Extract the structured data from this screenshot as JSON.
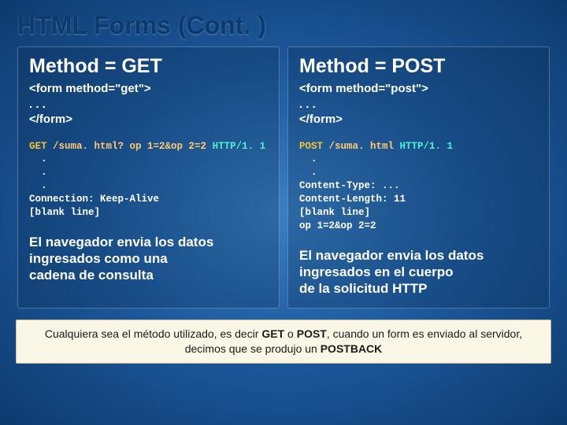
{
  "title": "HTML Forms (Cont. )",
  "left": {
    "heading": "Method = GET",
    "form_line1": "<form method=\"get\">",
    "form_line2": ". . .",
    "form_line3": "</form>",
    "http": {
      "method": "GET",
      "url": " /suma. html? op 1=2&op 2=2 ",
      "proto": "HTTP/1. 1",
      "body": "  .\n  .\n  .\nConnection: Keep-Alive\n[blank line]"
    },
    "explain_l1": "El navegador envia los datos",
    "explain_l2": "ingresados ​​como una",
    "explain_l3": "cadena de consulta"
  },
  "right": {
    "heading": "Method = POST",
    "form_line1": "<form method=\"post\">",
    "form_line2": ". . .",
    "form_line3": "</form>",
    "http": {
      "method": "POST",
      "url": " /suma. html ",
      "proto": "HTTP/1. 1",
      "body": "  .\n  .\nContent-Type: ...\nContent-Length: 11\n[blank line]\nop 1=2&op 2=2"
    },
    "explain_l1": "El navegador envia los datos",
    "explain_l2": "ingresados en el cuerpo",
    "explain_l3": "de la solicitud HTTP"
  },
  "footnote": {
    "pre": "Cualquiera sea el método utilizado, es decir ",
    "b1": "GET",
    "mid1": " o ",
    "b2": "POST",
    "mid2": ", cuando un form es enviado al servidor, decimos que se produjo un ",
    "b3": "POSTBACK"
  }
}
